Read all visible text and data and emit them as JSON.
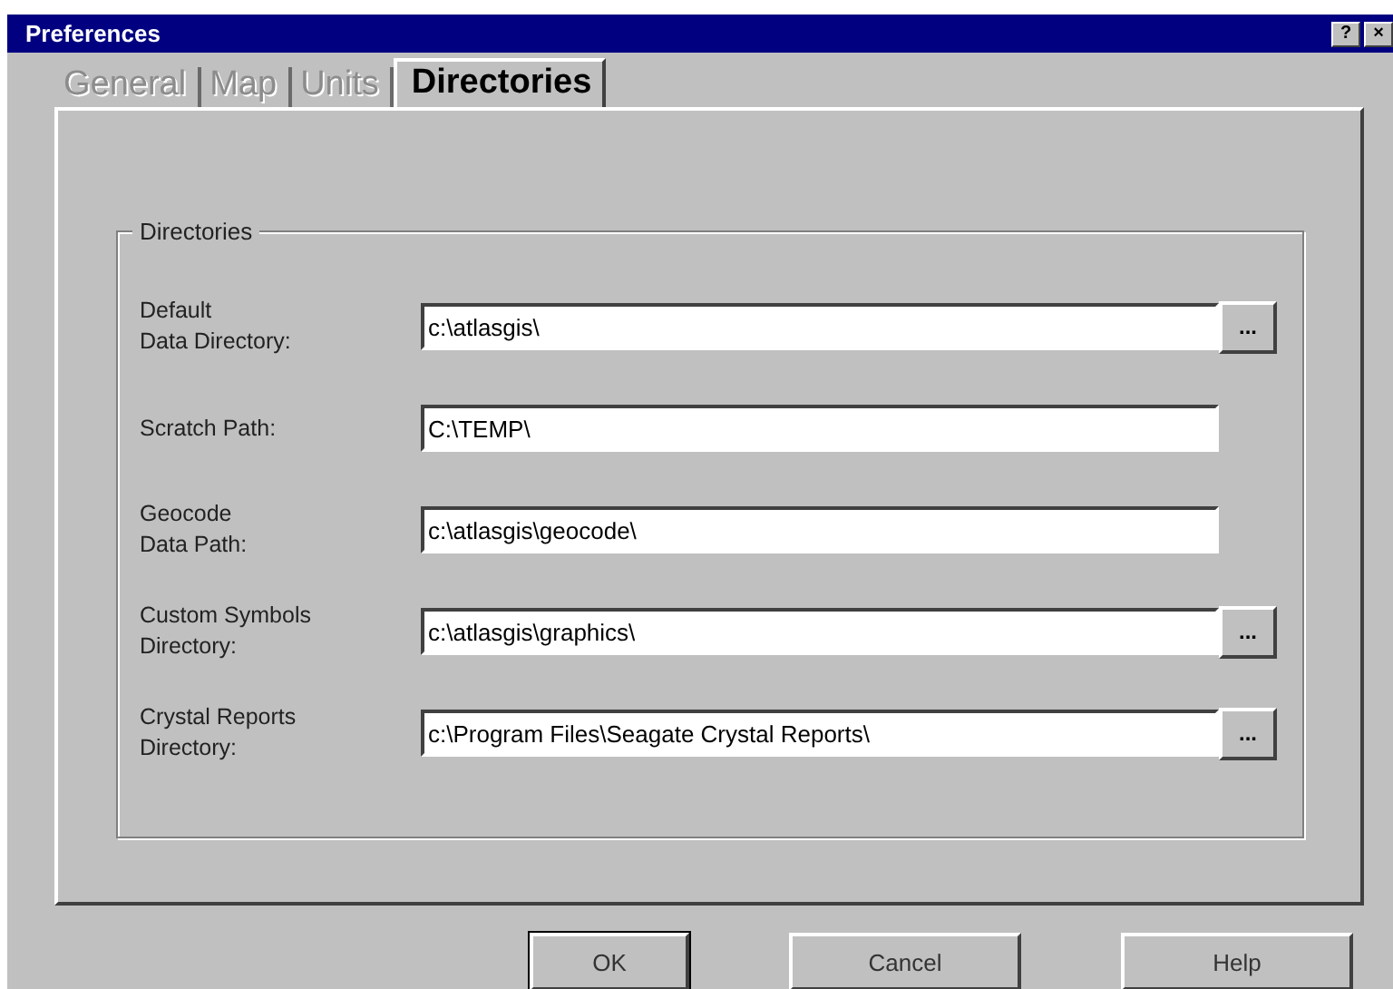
{
  "window": {
    "title": "Preferences",
    "help_button": "?",
    "close_button": "×"
  },
  "tabs": [
    {
      "label": "General",
      "selected": false,
      "disabled": true
    },
    {
      "label": "Map",
      "selected": false,
      "disabled": true
    },
    {
      "label": "Units",
      "selected": false,
      "disabled": true
    },
    {
      "label": "Directories",
      "selected": true,
      "disabled": false
    }
  ],
  "group": {
    "title": "Directories"
  },
  "fields": [
    {
      "label_lines": [
        "Default",
        "Data Directory:"
      ],
      "value": "c:\\atlasgis\\",
      "browse": "..."
    },
    {
      "label_lines": [
        "Scratch Path:"
      ],
      "value": "C:\\TEMP\\"
    },
    {
      "label_lines": [
        "Geocode",
        "Data Path:"
      ],
      "value": "c:\\atlasgis\\geocode\\"
    },
    {
      "label_lines": [
        "Custom Symbols",
        "Directory:"
      ],
      "value": "c:\\atlasgis\\graphics\\",
      "browse": "..."
    },
    {
      "label_lines": [
        "Crystal Reports",
        "Directory:"
      ],
      "value": "c:\\Program Files\\Seagate Crystal Reports\\",
      "browse": "..."
    }
  ],
  "buttons": [
    {
      "label": "OK",
      "default": true
    },
    {
      "label": "Cancel",
      "default": false
    },
    {
      "label": "Help",
      "default": false
    }
  ]
}
